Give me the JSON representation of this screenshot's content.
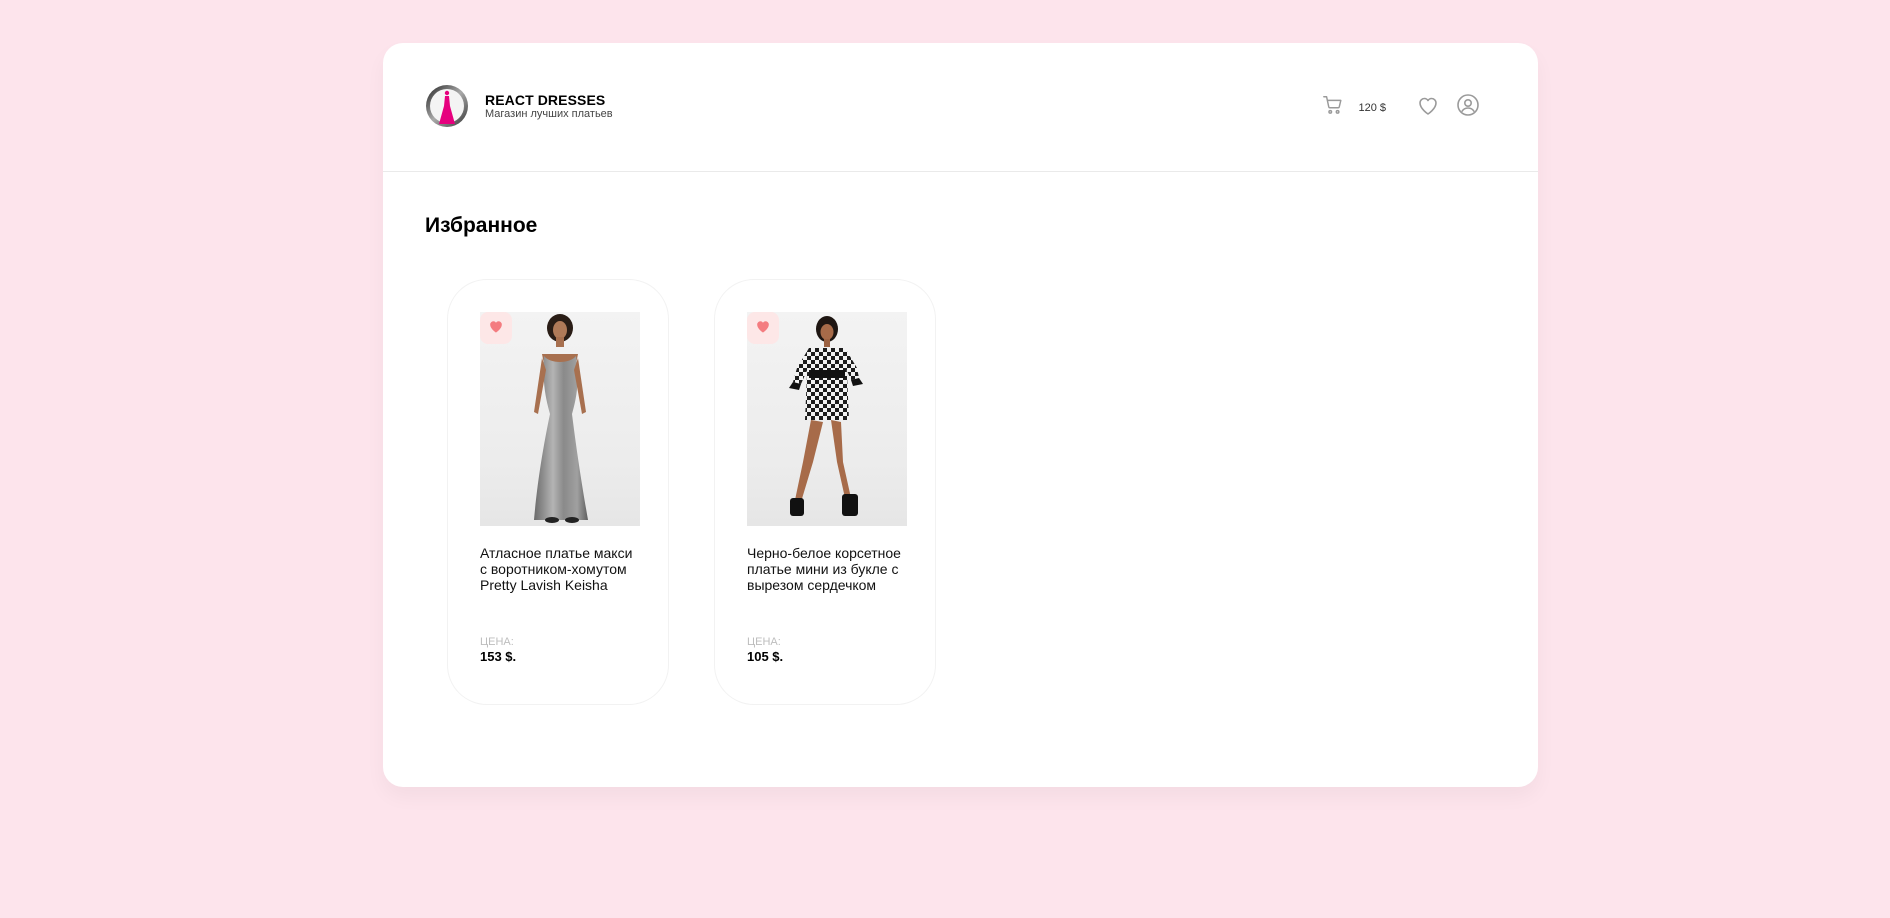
{
  "header": {
    "brand_title": "REACT DRESSES",
    "brand_subtitle": "Магазин лучших платьев",
    "cart_total": "120 $"
  },
  "page": {
    "title": "Избранное"
  },
  "products": [
    {
      "title": "Атласное платье макси с воротником-хомутом Pretty Lavish Keisha",
      "price_label": "ЦЕНА:",
      "price": "153 $.",
      "favorited": true
    },
    {
      "title": "Черно-белое корсетное платье мини из букле с вырезом сердечком",
      "price_label": "ЦЕНА:",
      "price": "105 $.",
      "favorited": true
    }
  ],
  "colors": {
    "background": "#fde4ec",
    "accent_heart": "#f47c80",
    "logo_pink": "#e6007e"
  },
  "icons": {
    "cart": "cart-icon",
    "favorites": "heart-outline-icon",
    "profile": "user-circle-icon",
    "favorited": "heart-filled-icon"
  }
}
